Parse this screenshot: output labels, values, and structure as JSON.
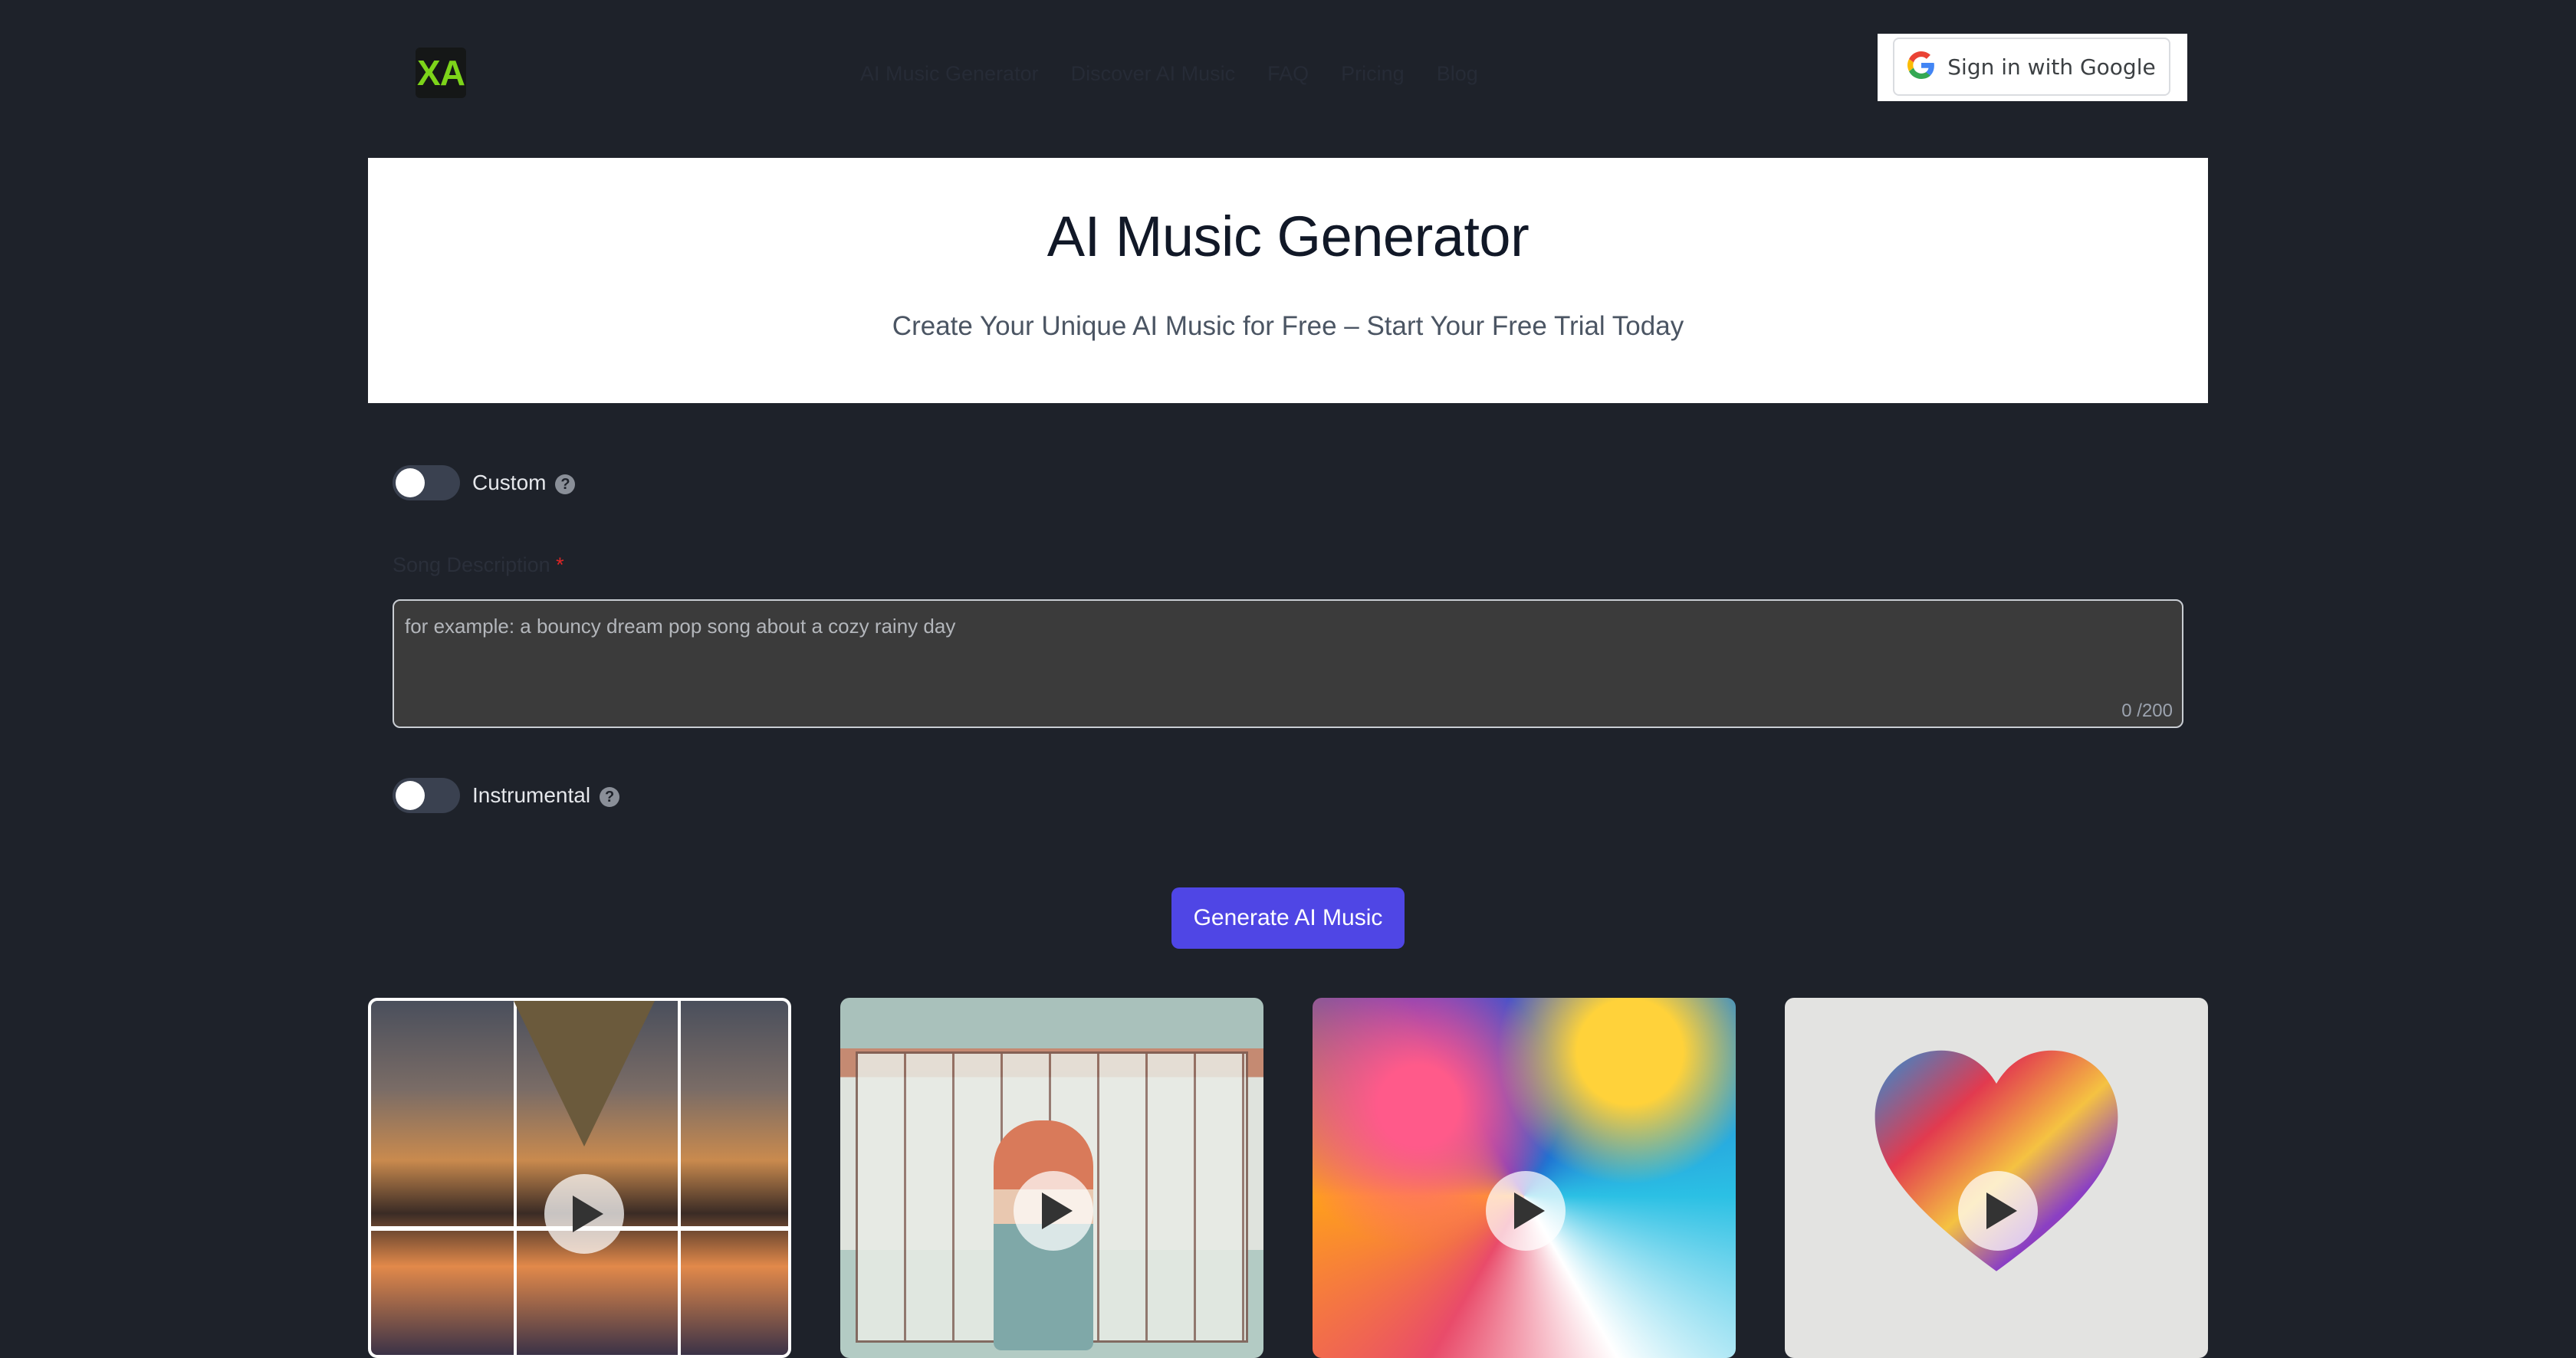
{
  "header": {
    "logo_text": "XA",
    "nav": [
      {
        "label": "AI Music Generator"
      },
      {
        "label": "Discover AI Music"
      },
      {
        "label": "FAQ"
      },
      {
        "label": "Pricing"
      },
      {
        "label": "Blog"
      }
    ],
    "google_signin_label": "Sign in with Google"
  },
  "hero": {
    "title": "AI Music Generator",
    "subtitle": "Create Your Unique AI Music for Free – Start Your Free Trial Today"
  },
  "form": {
    "custom_toggle_label": "Custom",
    "custom_toggle_on": false,
    "song_description_label": "Song Description",
    "required_marker": "*",
    "song_description_placeholder": "for example: a bouncy dream pop song about a cozy rainy day",
    "song_description_value": "",
    "char_counter": "0 /200",
    "instrumental_toggle_label": "Instrumental",
    "instrumental_toggle_on": false,
    "generate_button_label": "Generate AI Music"
  },
  "help_icon_glyph": "?",
  "cards": [
    {
      "icon": "play-icon"
    },
    {
      "icon": "play-icon"
    },
    {
      "icon": "play-icon"
    },
    {
      "icon": "play-icon"
    }
  ],
  "colors": {
    "background": "#1e222a",
    "accent": "#4f46e5",
    "logo_text": "#7dd41a",
    "required": "#dc2626"
  }
}
